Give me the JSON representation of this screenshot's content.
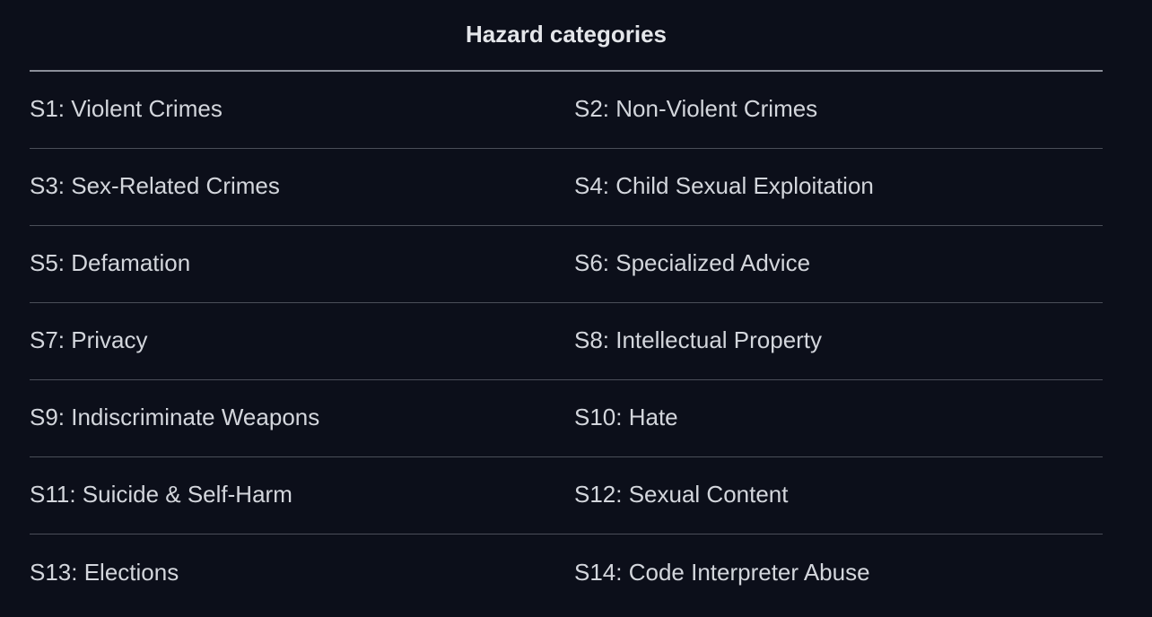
{
  "table": {
    "title": "Hazard categories",
    "rows": [
      {
        "left": "S1: Violent Crimes",
        "right": "S2: Non-Violent Crimes"
      },
      {
        "left": "S3: Sex-Related Crimes",
        "right": "S4: Child Sexual Exploitation"
      },
      {
        "left": "S5: Defamation",
        "right": "S6: Specialized Advice"
      },
      {
        "left": "S7: Privacy",
        "right": "S8: Intellectual Property"
      },
      {
        "left": "S9: Indiscriminate Weapons",
        "right": "S10: Hate"
      },
      {
        "left": "S11: Suicide & Self-Harm",
        "right": "S12: Sexual Content"
      },
      {
        "left": "S13: Elections",
        "right": "S14: Code Interpreter Abuse"
      }
    ]
  },
  "colors": {
    "background": "#0c0f1a",
    "text": "#d3d6dc",
    "header_rule": "#8b8f99",
    "row_rule": "#4a4e58"
  }
}
